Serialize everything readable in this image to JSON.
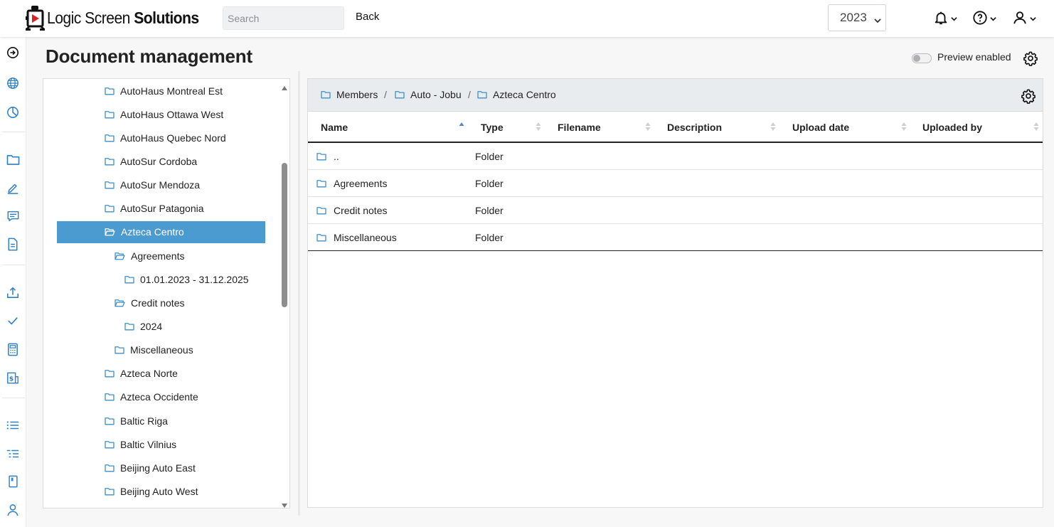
{
  "brand": {
    "name_light": "Logic Screen",
    "name_bold": "Solutions"
  },
  "header": {
    "search_placeholder": "Search",
    "back_label": "Back",
    "year": "2023",
    "icons": [
      "bell-icon",
      "help-circle-icon",
      "user-icon"
    ]
  },
  "colors": {
    "accent": "#4b9bd0",
    "folder": "#3d8fc9",
    "sort_active": "#5b86c5"
  },
  "page": {
    "title": "Document management",
    "preview_label": "Preview enabled",
    "preview_enabled": false
  },
  "rail": [
    "arrow-circle-right-icon",
    "globe-icon",
    "pie-chart-icon",
    "folder-icon",
    "edit-icon",
    "message-list-icon",
    "document-icon",
    "upload-icon",
    "check-icon",
    "calculator-icon",
    "invoice-dollar-icon",
    "list-icon",
    "list-indent-icon",
    "bookmark-book-icon",
    "person-icon"
  ],
  "tree": {
    "items": [
      {
        "label": "AutoHaus Montreal Est",
        "level": 0,
        "open": false,
        "selected": false
      },
      {
        "label": "AutoHaus Ottawa West",
        "level": 0,
        "open": false,
        "selected": false
      },
      {
        "label": "AutoHaus Quebec Nord",
        "level": 0,
        "open": false,
        "selected": false
      },
      {
        "label": "AutoSur Cordoba",
        "level": 0,
        "open": false,
        "selected": false
      },
      {
        "label": "AutoSur Mendoza",
        "level": 0,
        "open": false,
        "selected": false
      },
      {
        "label": "AutoSur Patagonia",
        "level": 0,
        "open": false,
        "selected": false
      },
      {
        "label": "Azteca Centro",
        "level": 0,
        "open": true,
        "selected": true
      },
      {
        "label": "Agreements",
        "level": 1,
        "open": true,
        "selected": false
      },
      {
        "label": "01.01.2023 - 31.12.2025",
        "level": 2,
        "open": false,
        "selected": false
      },
      {
        "label": "Credit notes",
        "level": 1,
        "open": true,
        "selected": false
      },
      {
        "label": "2024",
        "level": 2,
        "open": false,
        "selected": false
      },
      {
        "label": "Miscellaneous",
        "level": 1,
        "open": false,
        "selected": false
      },
      {
        "label": "Azteca Norte",
        "level": 0,
        "open": false,
        "selected": false
      },
      {
        "label": "Azteca Occidente",
        "level": 0,
        "open": false,
        "selected": false
      },
      {
        "label": "Baltic Riga",
        "level": 0,
        "open": false,
        "selected": false
      },
      {
        "label": "Baltic Vilnius",
        "level": 0,
        "open": false,
        "selected": false
      },
      {
        "label": "Beijing Auto East",
        "level": 0,
        "open": false,
        "selected": false
      },
      {
        "label": "Beijing Auto West",
        "level": 0,
        "open": false,
        "selected": false
      }
    ]
  },
  "breadcrumb": [
    "Members",
    "Auto - Jobu",
    "Azteca Centro"
  ],
  "table": {
    "columns": [
      "Name",
      "Type",
      "Filename",
      "Description",
      "Upload date",
      "Uploaded by"
    ],
    "sorted_column": "Name",
    "rows": [
      {
        "name": "..",
        "type": "Folder"
      },
      {
        "name": "Agreements",
        "type": "Folder"
      },
      {
        "name": "Credit notes",
        "type": "Folder"
      },
      {
        "name": "Miscellaneous",
        "type": "Folder"
      }
    ]
  }
}
